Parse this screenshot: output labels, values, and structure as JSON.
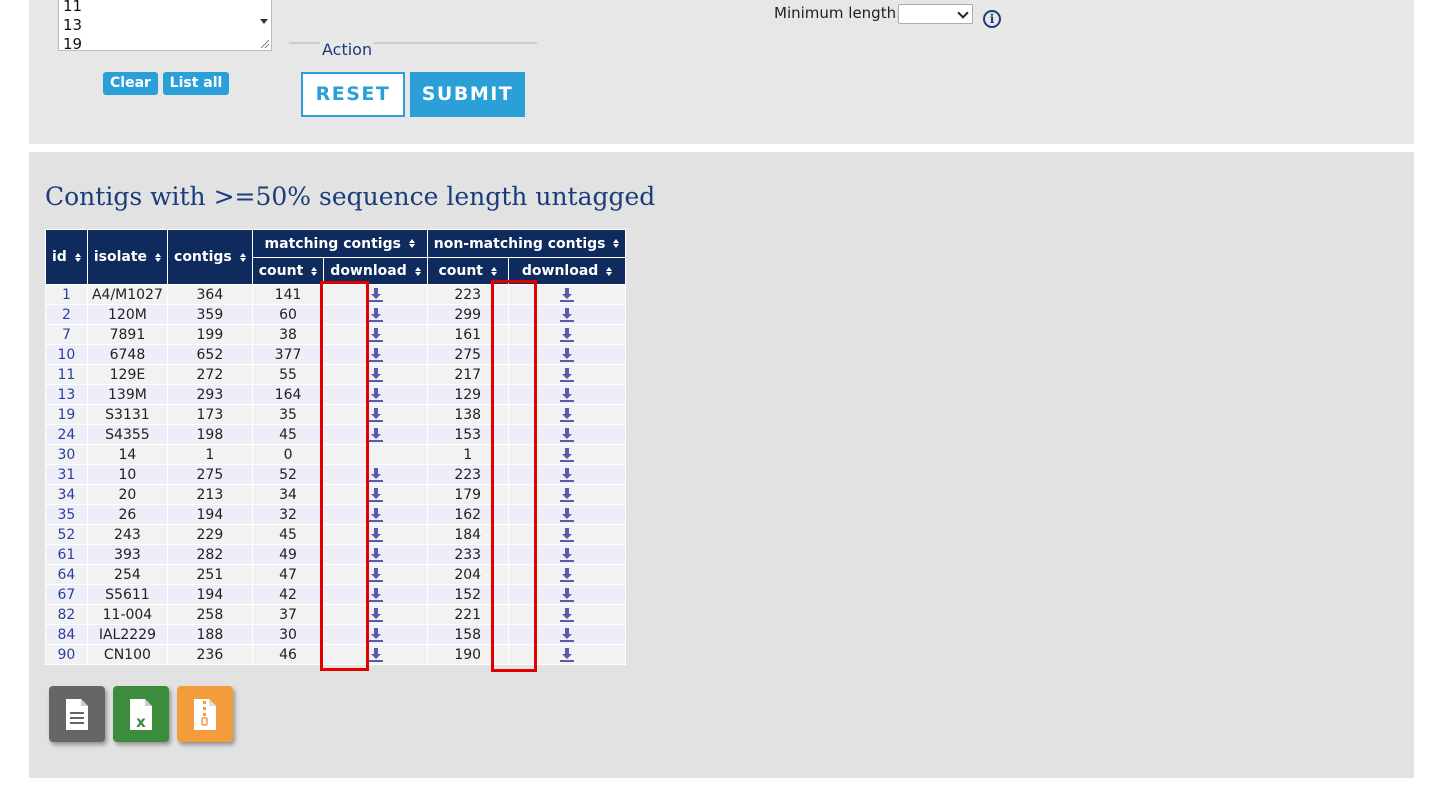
{
  "query_form": {
    "listbox_values": [
      "11",
      "13",
      "19"
    ],
    "clear_label": "Clear",
    "list_all_label": "List all",
    "action_legend": "Action",
    "reset_label": "RESET",
    "submit_label": "SUBMIT",
    "min_length_label": "Minimum length:",
    "min_length_value": ""
  },
  "results": {
    "title": "Contigs with >=50% sequence length untagged",
    "headers": {
      "id": "id",
      "isolate": "isolate",
      "contigs": "contigs",
      "matching": "matching contigs",
      "non_matching": "non-matching contigs",
      "count": "count",
      "download": "download"
    },
    "rows": [
      {
        "id": "1",
        "isolate": "A4/M1027",
        "contigs": "364",
        "matching_count": "141",
        "matching_download": true,
        "nonmatching_count": "223",
        "nonmatching_download": true
      },
      {
        "id": "2",
        "isolate": "120M",
        "contigs": "359",
        "matching_count": "60",
        "matching_download": true,
        "nonmatching_count": "299",
        "nonmatching_download": true
      },
      {
        "id": "7",
        "isolate": "7891",
        "contigs": "199",
        "matching_count": "38",
        "matching_download": true,
        "nonmatching_count": "161",
        "nonmatching_download": true
      },
      {
        "id": "10",
        "isolate": "6748",
        "contigs": "652",
        "matching_count": "377",
        "matching_download": true,
        "nonmatching_count": "275",
        "nonmatching_download": true
      },
      {
        "id": "11",
        "isolate": "129E",
        "contigs": "272",
        "matching_count": "55",
        "matching_download": true,
        "nonmatching_count": "217",
        "nonmatching_download": true
      },
      {
        "id": "13",
        "isolate": "139M",
        "contigs": "293",
        "matching_count": "164",
        "matching_download": true,
        "nonmatching_count": "129",
        "nonmatching_download": true
      },
      {
        "id": "19",
        "isolate": "S3131",
        "contigs": "173",
        "matching_count": "35",
        "matching_download": true,
        "nonmatching_count": "138",
        "nonmatching_download": true
      },
      {
        "id": "24",
        "isolate": "S4355",
        "contigs": "198",
        "matching_count": "45",
        "matching_download": true,
        "nonmatching_count": "153",
        "nonmatching_download": true
      },
      {
        "id": "30",
        "isolate": "14",
        "contigs": "1",
        "matching_count": "0",
        "matching_download": false,
        "nonmatching_count": "1",
        "nonmatching_download": true
      },
      {
        "id": "31",
        "isolate": "10",
        "contigs": "275",
        "matching_count": "52",
        "matching_download": true,
        "nonmatching_count": "223",
        "nonmatching_download": true
      },
      {
        "id": "34",
        "isolate": "20",
        "contigs": "213",
        "matching_count": "34",
        "matching_download": true,
        "nonmatching_count": "179",
        "nonmatching_download": true
      },
      {
        "id": "35",
        "isolate": "26",
        "contigs": "194",
        "matching_count": "32",
        "matching_download": true,
        "nonmatching_count": "162",
        "nonmatching_download": true
      },
      {
        "id": "52",
        "isolate": "243",
        "contigs": "229",
        "matching_count": "45",
        "matching_download": true,
        "nonmatching_count": "184",
        "nonmatching_download": true
      },
      {
        "id": "61",
        "isolate": "393",
        "contigs": "282",
        "matching_count": "49",
        "matching_download": true,
        "nonmatching_count": "233",
        "nonmatching_download": true
      },
      {
        "id": "64",
        "isolate": "254",
        "contigs": "251",
        "matching_count": "47",
        "matching_download": true,
        "nonmatching_count": "204",
        "nonmatching_download": true
      },
      {
        "id": "67",
        "isolate": "S5611",
        "contigs": "194",
        "matching_count": "42",
        "matching_download": true,
        "nonmatching_count": "152",
        "nonmatching_download": true
      },
      {
        "id": "82",
        "isolate": "11-004",
        "contigs": "258",
        "matching_count": "37",
        "matching_download": true,
        "nonmatching_count": "221",
        "nonmatching_download": true
      },
      {
        "id": "84",
        "isolate": "IAL2229",
        "contigs": "188",
        "matching_count": "30",
        "matching_download": true,
        "nonmatching_count": "158",
        "nonmatching_download": true
      },
      {
        "id": "90",
        "isolate": "CN100",
        "contigs": "236",
        "matching_count": "46",
        "matching_download": true,
        "nonmatching_count": "190",
        "nonmatching_download": true
      }
    ]
  },
  "exports": {
    "text_icon": "text-file-icon",
    "excel_icon": "excel-file-icon",
    "zip_icon": "zip-file-icon"
  },
  "colors": {
    "accent": "#2a9fd8",
    "header_bg": "#0f2a5c",
    "title": "#1a3c7a",
    "highlight": "#e00000",
    "export_text": "#666666",
    "export_excel": "#3d8b3d",
    "export_zip": "#f39c3c"
  }
}
